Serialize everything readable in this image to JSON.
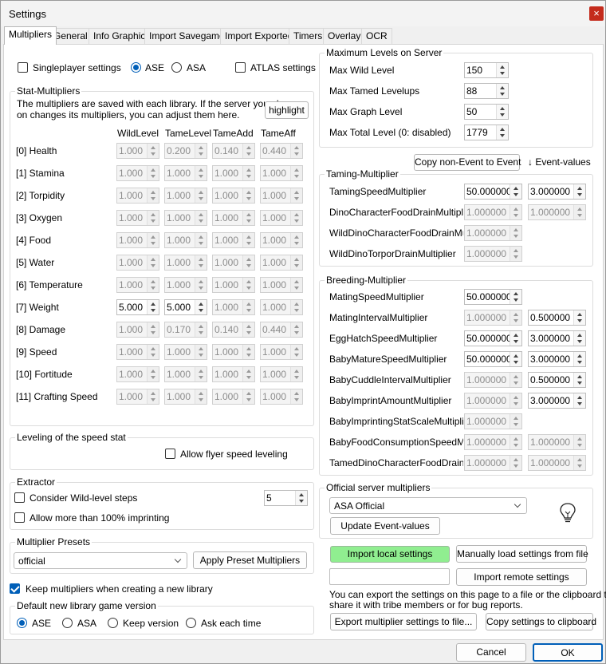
{
  "window": {
    "title": "Settings",
    "close": "×"
  },
  "tabs": [
    "Multipliers",
    "General",
    "Info Graphic",
    "Import Savegame",
    "Import Exported",
    "Timers",
    "Overlay",
    "OCR"
  ],
  "top": {
    "singleplayer": "Singleplayer settings",
    "ase": "ASE",
    "asa": "ASA",
    "atlas": "ATLAS settings"
  },
  "stat": {
    "title": "Stat-Multipliers",
    "info_line1": "The multipliers are saved with each library. If the server you play",
    "info_line2": "on changes its multipliers, you can adjust them here.",
    "highlight": "highlight",
    "headers": [
      "WildLevel",
      "TameLevel",
      "TameAdd",
      "TameAff"
    ],
    "rows": [
      {
        "name": "[0] Health",
        "values": [
          "1.000",
          "0.200",
          "0.140",
          "0.440"
        ],
        "active": [
          false,
          false,
          false,
          false
        ]
      },
      {
        "name": "[1] Stamina",
        "values": [
          "1.000",
          "1.000",
          "1.000",
          "1.000"
        ],
        "active": [
          false,
          false,
          false,
          false
        ]
      },
      {
        "name": "[2] Torpidity",
        "values": [
          "1.000",
          "1.000",
          "1.000",
          "1.000"
        ],
        "active": [
          false,
          false,
          false,
          false
        ]
      },
      {
        "name": "[3] Oxygen",
        "values": [
          "1.000",
          "1.000",
          "1.000",
          "1.000"
        ],
        "active": [
          false,
          false,
          false,
          false
        ]
      },
      {
        "name": "[4] Food",
        "values": [
          "1.000",
          "1.000",
          "1.000",
          "1.000"
        ],
        "active": [
          false,
          false,
          false,
          false
        ]
      },
      {
        "name": "[5] Water",
        "values": [
          "1.000",
          "1.000",
          "1.000",
          "1.000"
        ],
        "active": [
          false,
          false,
          false,
          false
        ]
      },
      {
        "name": "[6] Temperature",
        "values": [
          "1.000",
          "1.000",
          "1.000",
          "1.000"
        ],
        "active": [
          false,
          false,
          false,
          false
        ]
      },
      {
        "name": "[7] Weight",
        "values": [
          "5.000",
          "5.000",
          "1.000",
          "1.000"
        ],
        "active": [
          true,
          true,
          false,
          false
        ]
      },
      {
        "name": "[8] Damage",
        "values": [
          "1.000",
          "0.170",
          "0.140",
          "0.440"
        ],
        "active": [
          false,
          false,
          false,
          false
        ]
      },
      {
        "name": "[9] Speed",
        "values": [
          "1.000",
          "1.000",
          "1.000",
          "1.000"
        ],
        "active": [
          false,
          false,
          false,
          false
        ]
      },
      {
        "name": "[10] Fortitude",
        "values": [
          "1.000",
          "1.000",
          "1.000",
          "1.000"
        ],
        "active": [
          false,
          false,
          false,
          false
        ]
      },
      {
        "name": "[11] Crafting Speed",
        "values": [
          "1.000",
          "1.000",
          "1.000",
          "1.000"
        ],
        "active": [
          false,
          false,
          false,
          false
        ]
      }
    ]
  },
  "speed": {
    "title": "Leveling of the speed stat",
    "flyer": "Allow flyer speed leveling"
  },
  "extractor": {
    "title": "Extractor",
    "wild_steps": "Consider Wild-level steps",
    "steps_value": "5",
    "imprint": "Allow more than 100% imprinting"
  },
  "presets": {
    "title": "Multiplier Presets",
    "selected": "official",
    "apply": "Apply Preset Multipliers"
  },
  "keep": "Keep multipliers when creating a new library",
  "default_version": {
    "title": "Default new library game version",
    "options": [
      "ASE",
      "ASA",
      "Keep version",
      "Ask each time"
    ]
  },
  "max_levels": {
    "title": "Maximum Levels on Server",
    "rows": [
      {
        "label": "Max Wild Level",
        "value": "150"
      },
      {
        "label": "Max Tamed Levelups",
        "value": "88"
      },
      {
        "label": "Max Graph Level",
        "value": "50"
      },
      {
        "label": "Max Total Level (0: disabled)",
        "value": "1779"
      }
    ]
  },
  "copy_event": "Copy non-Event to Event",
  "event_values": "↓ Event-values",
  "taming": {
    "title": "Taming-Multiplier",
    "rows": [
      {
        "label": "TamingSpeedMultiplier",
        "value": "50.000000",
        "event": "3.000000",
        "active": true,
        "event_active": true
      },
      {
        "label": "DinoCharacterFoodDrainMultiplier",
        "value": "1.000000",
        "event": "1.000000",
        "active": false,
        "event_active": false
      },
      {
        "label": "WildDinoCharacterFoodDrainMultipli",
        "value": "1.000000",
        "event": "",
        "active": false,
        "event_active": false
      },
      {
        "label": "WildDinoTorporDrainMultiplier",
        "value": "1.000000",
        "event": "",
        "active": false,
        "event_active": false
      }
    ]
  },
  "breeding": {
    "title": "Breeding-Multiplier",
    "rows": [
      {
        "label": "MatingSpeedMultiplier",
        "value": "50.000000",
        "event": "",
        "active": true,
        "event_active": false
      },
      {
        "label": "MatingIntervalMultiplier",
        "value": "1.000000",
        "event": "0.500000",
        "active": false,
        "event_active": true
      },
      {
        "label": "EggHatchSpeedMultiplier",
        "value": "50.000000",
        "event": "3.000000",
        "active": true,
        "event_active": true
      },
      {
        "label": "BabyMatureSpeedMultiplier",
        "value": "50.000000",
        "event": "3.000000",
        "active": true,
        "event_active": true
      },
      {
        "label": "BabyCuddleIntervalMultiplier",
        "value": "1.000000",
        "event": "0.500000",
        "active": false,
        "event_active": true
      },
      {
        "label": "BabyImprintAmountMultiplier",
        "value": "1.000000",
        "event": "3.000000",
        "active": false,
        "event_active": true
      },
      {
        "label": "BabyImprintingStatScaleMultiplier",
        "value": "1.000000",
        "event": "",
        "active": false,
        "event_active": false
      },
      {
        "label": "BabyFoodConsumptionSpeedMult",
        "value": "1.000000",
        "event": "1.000000",
        "active": false,
        "event_active": false
      },
      {
        "label": "TamedDinoCharacterFoodDrainMult",
        "value": "1.000000",
        "event": "1.000000",
        "active": false,
        "event_active": false
      }
    ]
  },
  "official": {
    "title": "Official server multipliers",
    "selected": "ASA Official",
    "update": "Update Event-values"
  },
  "import": {
    "local": "Import local settings",
    "manual": "Manually load settings from file",
    "remote": "Import remote settings",
    "info_line1": "You can export the settings on this page to a file or the clipboard to",
    "info_line2": "share it with tribe members or for bug reports.",
    "export_file": "Export multiplier settings to file...",
    "copy_clip": "Copy settings to clipboard"
  },
  "footer": {
    "cancel": "Cancel",
    "ok": "OK"
  },
  "colors": {
    "accent": "#005fb8",
    "import_local_bg": "#90ee90"
  }
}
